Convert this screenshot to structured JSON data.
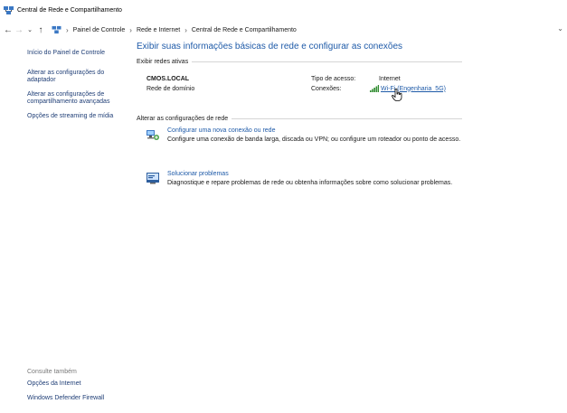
{
  "window": {
    "title": "Central de Rede e Compartilhamento"
  },
  "address": {
    "breadcrumbs": [
      "Painel de Controle",
      "Rede e Internet",
      "Central de Rede e Compartilhamento"
    ]
  },
  "sidebar": {
    "home": "Início do Painel de Controle",
    "links": [
      "Alterar as configurações do adaptador",
      "Alterar as configurações de compartilhamento avançadas",
      "Opções de streaming de mídia"
    ],
    "see_also_title": "Consulte também",
    "see_also": [
      "Opções da Internet",
      "Windows Defender Firewall"
    ]
  },
  "main": {
    "title": "Exibir suas informações básicas de rede e configurar as conexões",
    "active_networks_header": "Exibir redes ativas",
    "network": {
      "name": "CMOS.LOCAL",
      "type": "Rede de domínio",
      "access_label": "Tipo de acesso:",
      "access_value": "Internet",
      "connections_label": "Conexões:",
      "connection_link": "Wi-Fi (Engenharia_5G)"
    },
    "change_settings_header": "Alterar as configurações de rede",
    "tasks": [
      {
        "icon": "network-setup-icon",
        "title": "Configurar uma nova conexão ou rede",
        "desc": "Configure uma conexão de banda larga, discada ou VPN; ou configure um roteador ou ponto de acesso."
      },
      {
        "icon": "troubleshoot-icon",
        "title": "Solucionar problemas",
        "desc": "Diagnostique e repare problemas de rede ou obtenha informações sobre como solucionar problemas."
      }
    ]
  }
}
